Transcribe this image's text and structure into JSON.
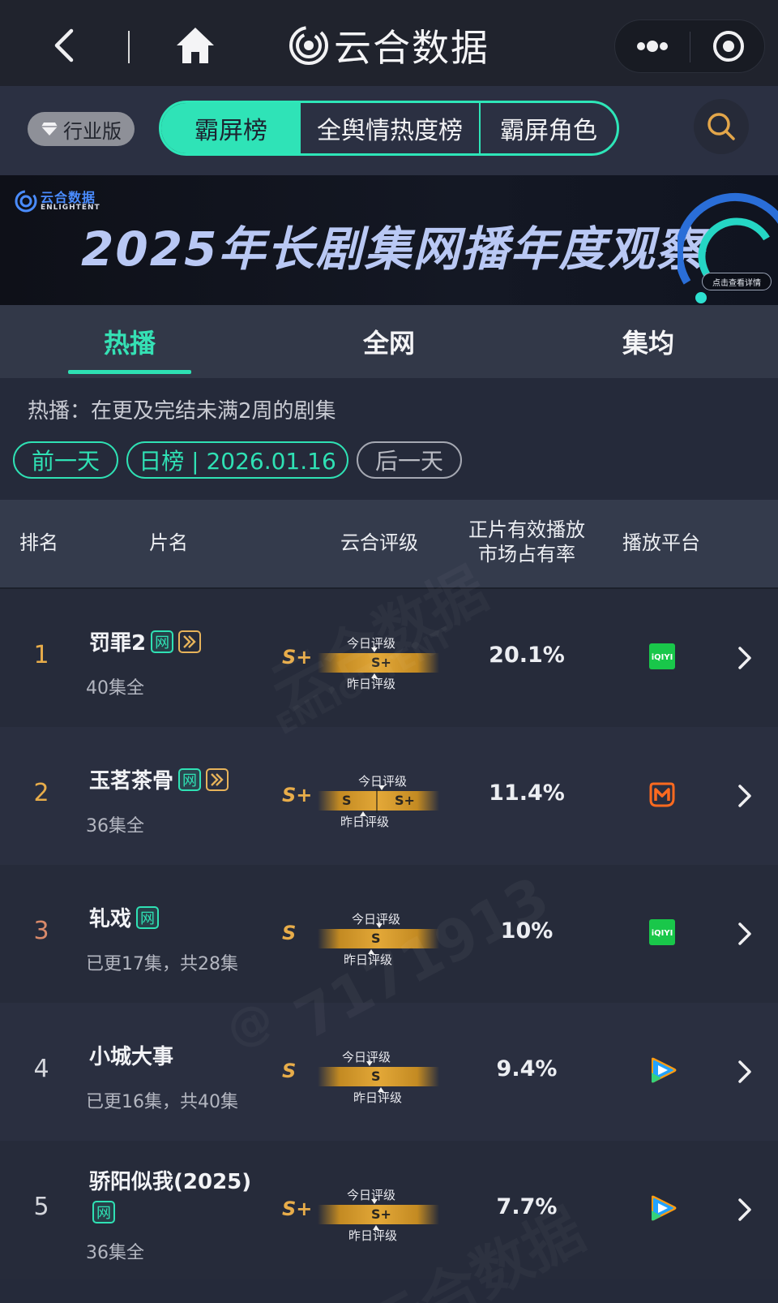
{
  "header": {
    "app_title": "云合数据",
    "icons": {
      "back": "chevron-left-icon",
      "home": "home-icon",
      "more": "more-dots-icon",
      "target": "target-icon",
      "logo": "yunhe-logo-icon"
    }
  },
  "category_bar": {
    "edition_badge": "行业版",
    "segments": [
      "霸屏榜",
      "全舆情热度榜",
      "霸屏角色"
    ],
    "active_segment": 0,
    "accent_color": "#2fe3b7"
  },
  "banner": {
    "logo_cn": "云合数据",
    "logo_en": "ENLIGHTENT",
    "title": "2025年长剧集网播年度观察",
    "cta": "点击查看详情"
  },
  "tabs": {
    "items": [
      "热播",
      "全网",
      "集均"
    ],
    "active": 0
  },
  "description": "热播：在更及完结未满2周的剧集",
  "date_nav": {
    "prev": "前一天",
    "current": "日榜 | 2026.01.16",
    "next": "后一天"
  },
  "table": {
    "headers": {
      "rank": "排名",
      "title": "片名",
      "rating": "云合评级",
      "share_line1": "正片有效播放",
      "share_line2": "市场占有率",
      "platform": "播放平台"
    },
    "gauge_labels": {
      "today": "今日评级",
      "yesterday": "昨日评级"
    },
    "net_tag": "网",
    "rows": [
      {
        "rank": "1",
        "title": "罚罪2",
        "episodes": "40集全",
        "grade": "S+",
        "gauge_left": "",
        "gauge_right": "S+",
        "share": "20.1%",
        "platform": "iqiyi-icon",
        "has_play_tag": true,
        "rank_color": "#e8ad4a"
      },
      {
        "rank": "2",
        "title": "玉茗茶骨",
        "episodes": "36集全",
        "grade": "S+",
        "gauge_left": "S",
        "gauge_right": "S+",
        "share": "11.4%",
        "platform": "mangotv-icon",
        "has_play_tag": true,
        "rank_color": "#e8ad4a"
      },
      {
        "rank": "3",
        "title": "轧戏",
        "episodes": "已更17集，共28集",
        "grade": "S",
        "gauge_left": "",
        "gauge_right": "S",
        "share": "10%",
        "platform": "iqiyi-icon",
        "has_play_tag": false,
        "rank_color": "#d98a6a"
      },
      {
        "rank": "4",
        "title": "小城大事",
        "episodes": "已更16集，共40集",
        "grade": "S",
        "gauge_left": "",
        "gauge_right": "S",
        "share": "9.4%",
        "platform": "tencent-video-icon",
        "has_play_tag": false,
        "rank_color": "#d4d6dc"
      },
      {
        "rank": "5",
        "title": "骄阳似我(2025)",
        "episodes": "36集全",
        "grade": "S+",
        "gauge_left": "",
        "gauge_right": "S+",
        "share": "7.7%",
        "platform": "tencent-video-icon",
        "has_play_tag": false,
        "rank_color": "#d4d6dc"
      }
    ]
  },
  "watermark": {
    "text_a": "云合数据",
    "text_b": "ENLIGHTENT",
    "text_c": "7171913",
    "text_d": "@"
  }
}
